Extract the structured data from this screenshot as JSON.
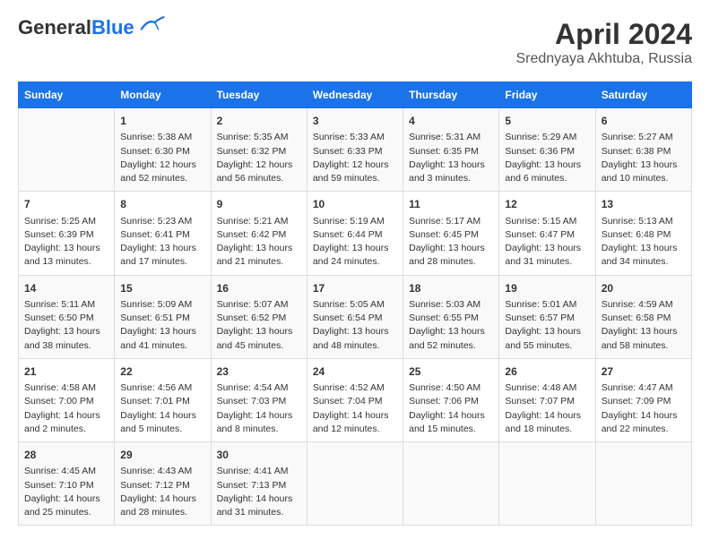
{
  "header": {
    "logo_general": "General",
    "logo_blue": "Blue",
    "title": "April 2024",
    "subtitle": "Srednyaya Akhtuba, Russia"
  },
  "weekdays": [
    "Sunday",
    "Monday",
    "Tuesday",
    "Wednesday",
    "Thursday",
    "Friday",
    "Saturday"
  ],
  "rows": [
    [
      {
        "day": "",
        "info": ""
      },
      {
        "day": "1",
        "info": "Sunrise: 5:38 AM\nSunset: 6:30 PM\nDaylight: 12 hours\nand 52 minutes."
      },
      {
        "day": "2",
        "info": "Sunrise: 5:35 AM\nSunset: 6:32 PM\nDaylight: 12 hours\nand 56 minutes."
      },
      {
        "day": "3",
        "info": "Sunrise: 5:33 AM\nSunset: 6:33 PM\nDaylight: 12 hours\nand 59 minutes."
      },
      {
        "day": "4",
        "info": "Sunrise: 5:31 AM\nSunset: 6:35 PM\nDaylight: 13 hours\nand 3 minutes."
      },
      {
        "day": "5",
        "info": "Sunrise: 5:29 AM\nSunset: 6:36 PM\nDaylight: 13 hours\nand 6 minutes."
      },
      {
        "day": "6",
        "info": "Sunrise: 5:27 AM\nSunset: 6:38 PM\nDaylight: 13 hours\nand 10 minutes."
      }
    ],
    [
      {
        "day": "7",
        "info": "Sunrise: 5:25 AM\nSunset: 6:39 PM\nDaylight: 13 hours\nand 13 minutes."
      },
      {
        "day": "8",
        "info": "Sunrise: 5:23 AM\nSunset: 6:41 PM\nDaylight: 13 hours\nand 17 minutes."
      },
      {
        "day": "9",
        "info": "Sunrise: 5:21 AM\nSunset: 6:42 PM\nDaylight: 13 hours\nand 21 minutes."
      },
      {
        "day": "10",
        "info": "Sunrise: 5:19 AM\nSunset: 6:44 PM\nDaylight: 13 hours\nand 24 minutes."
      },
      {
        "day": "11",
        "info": "Sunrise: 5:17 AM\nSunset: 6:45 PM\nDaylight: 13 hours\nand 28 minutes."
      },
      {
        "day": "12",
        "info": "Sunrise: 5:15 AM\nSunset: 6:47 PM\nDaylight: 13 hours\nand 31 minutes."
      },
      {
        "day": "13",
        "info": "Sunrise: 5:13 AM\nSunset: 6:48 PM\nDaylight: 13 hours\nand 34 minutes."
      }
    ],
    [
      {
        "day": "14",
        "info": "Sunrise: 5:11 AM\nSunset: 6:50 PM\nDaylight: 13 hours\nand 38 minutes."
      },
      {
        "day": "15",
        "info": "Sunrise: 5:09 AM\nSunset: 6:51 PM\nDaylight: 13 hours\nand 41 minutes."
      },
      {
        "day": "16",
        "info": "Sunrise: 5:07 AM\nSunset: 6:52 PM\nDaylight: 13 hours\nand 45 minutes."
      },
      {
        "day": "17",
        "info": "Sunrise: 5:05 AM\nSunset: 6:54 PM\nDaylight: 13 hours\nand 48 minutes."
      },
      {
        "day": "18",
        "info": "Sunrise: 5:03 AM\nSunset: 6:55 PM\nDaylight: 13 hours\nand 52 minutes."
      },
      {
        "day": "19",
        "info": "Sunrise: 5:01 AM\nSunset: 6:57 PM\nDaylight: 13 hours\nand 55 minutes."
      },
      {
        "day": "20",
        "info": "Sunrise: 4:59 AM\nSunset: 6:58 PM\nDaylight: 13 hours\nand 58 minutes."
      }
    ],
    [
      {
        "day": "21",
        "info": "Sunrise: 4:58 AM\nSunset: 7:00 PM\nDaylight: 14 hours\nand 2 minutes."
      },
      {
        "day": "22",
        "info": "Sunrise: 4:56 AM\nSunset: 7:01 PM\nDaylight: 14 hours\nand 5 minutes."
      },
      {
        "day": "23",
        "info": "Sunrise: 4:54 AM\nSunset: 7:03 PM\nDaylight: 14 hours\nand 8 minutes."
      },
      {
        "day": "24",
        "info": "Sunrise: 4:52 AM\nSunset: 7:04 PM\nDaylight: 14 hours\nand 12 minutes."
      },
      {
        "day": "25",
        "info": "Sunrise: 4:50 AM\nSunset: 7:06 PM\nDaylight: 14 hours\nand 15 minutes."
      },
      {
        "day": "26",
        "info": "Sunrise: 4:48 AM\nSunset: 7:07 PM\nDaylight: 14 hours\nand 18 minutes."
      },
      {
        "day": "27",
        "info": "Sunrise: 4:47 AM\nSunset: 7:09 PM\nDaylight: 14 hours\nand 22 minutes."
      }
    ],
    [
      {
        "day": "28",
        "info": "Sunrise: 4:45 AM\nSunset: 7:10 PM\nDaylight: 14 hours\nand 25 minutes."
      },
      {
        "day": "29",
        "info": "Sunrise: 4:43 AM\nSunset: 7:12 PM\nDaylight: 14 hours\nand 28 minutes."
      },
      {
        "day": "30",
        "info": "Sunrise: 4:41 AM\nSunset: 7:13 PM\nDaylight: 14 hours\nand 31 minutes."
      },
      {
        "day": "",
        "info": ""
      },
      {
        "day": "",
        "info": ""
      },
      {
        "day": "",
        "info": ""
      },
      {
        "day": "",
        "info": ""
      }
    ]
  ]
}
